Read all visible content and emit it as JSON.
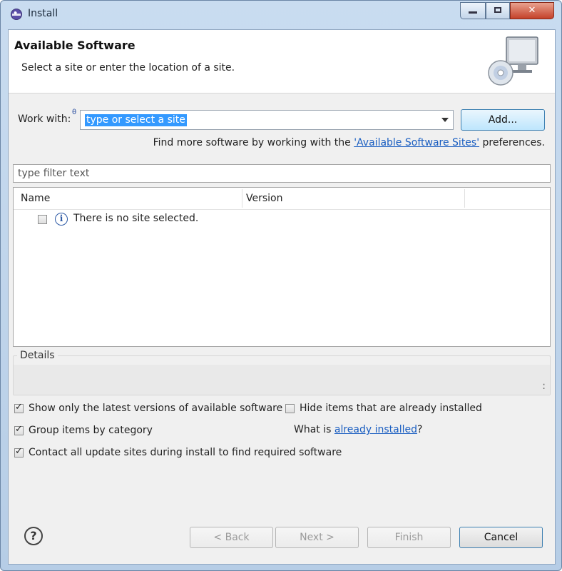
{
  "window": {
    "title": "Install",
    "controls": {
      "minimize": "",
      "maximize": "",
      "close": "✕"
    }
  },
  "banner": {
    "title": "Available Software",
    "subtitle": "Select a site or enter the location of a site."
  },
  "work_with": {
    "label": "Work with:",
    "info_mark": "θ",
    "value": "type or select a site",
    "add_label": "Add..."
  },
  "find_more": {
    "prefix": "Find more software by working with the ",
    "link": "'Available Software Sites'",
    "suffix": " preferences."
  },
  "filter": {
    "placeholder": "type filter text"
  },
  "tree": {
    "columns": [
      "Name",
      "Version"
    ],
    "rows": [
      {
        "checked": false,
        "icon": "info-icon",
        "text": "There is no site selected."
      }
    ]
  },
  "details": {
    "label": "Details",
    "scroll_mark": ":"
  },
  "options": {
    "show_latest": {
      "checked": true,
      "label": "Show only the latest versions of available software"
    },
    "hide_installed": {
      "checked": false,
      "label": "Hide items that are already installed"
    },
    "group_by_category": {
      "checked": true,
      "label": "Group items by category"
    },
    "contact_all": {
      "checked": true,
      "label": "Contact all update sites during install to find required software"
    },
    "what_is": {
      "prefix": "What is ",
      "link": "already installed",
      "suffix": "?"
    }
  },
  "footer": {
    "help": "?",
    "back": "< Back",
    "next": "Next >",
    "finish": "Finish",
    "cancel": "Cancel"
  }
}
